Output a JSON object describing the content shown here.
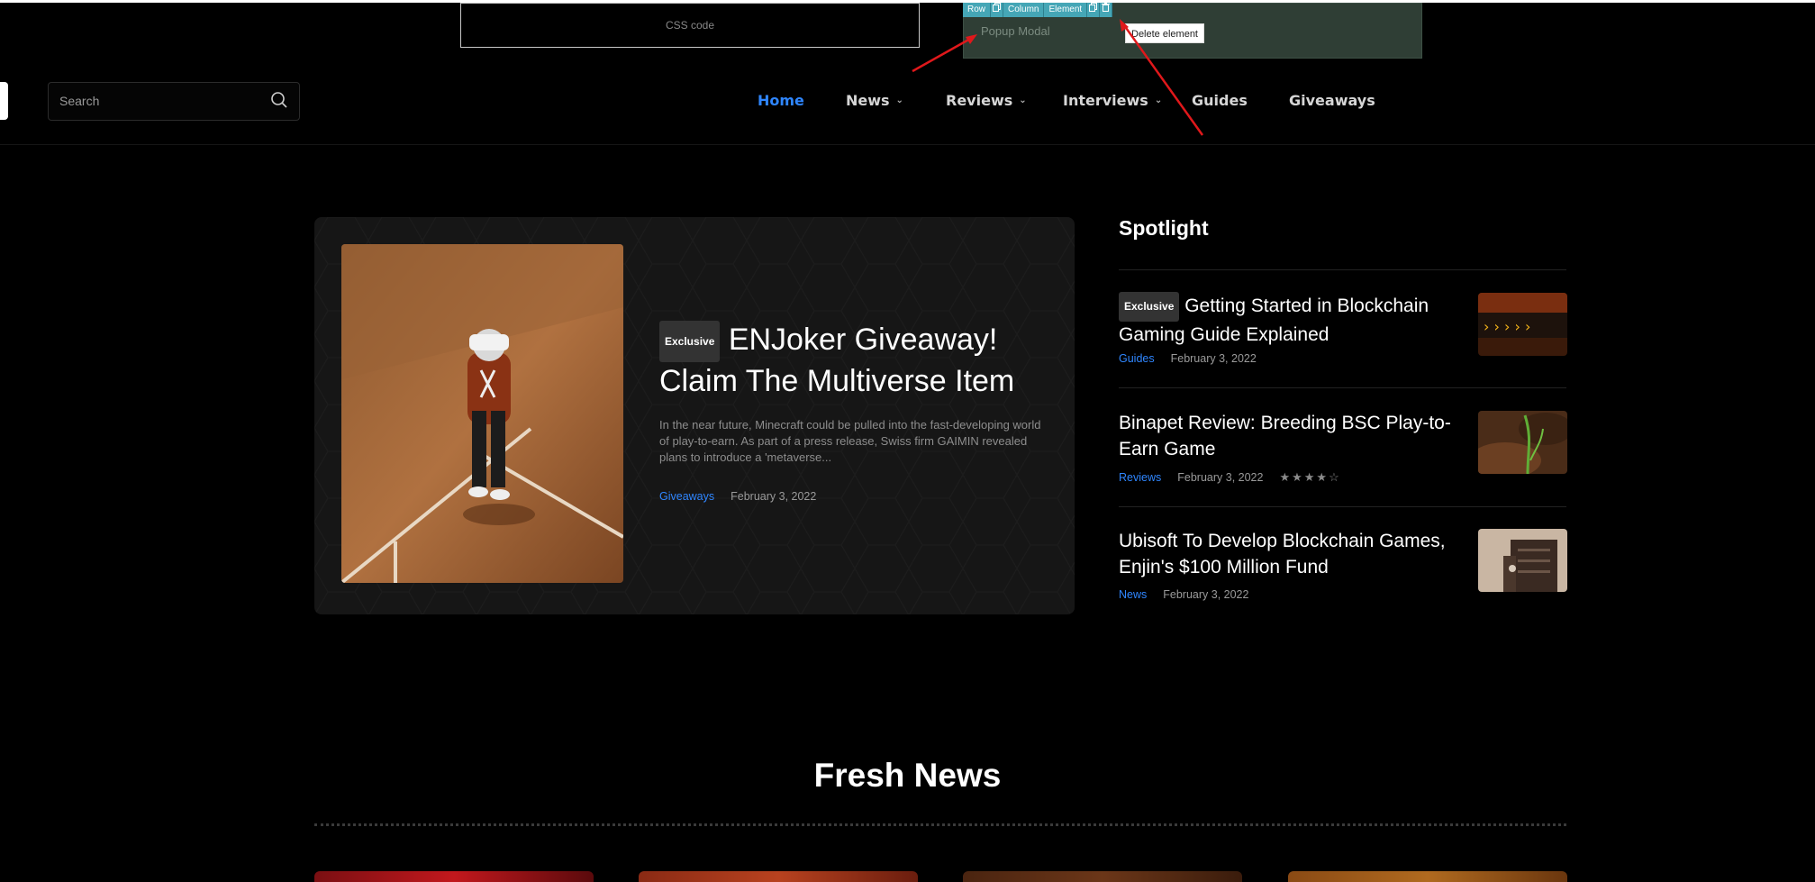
{
  "editor": {
    "css_code_label": "CSS code",
    "modal_label": "Popup Modal",
    "toolbar": [
      "Row",
      "Column",
      "Element"
    ],
    "tooltip": "Delete element"
  },
  "header": {
    "search_placeholder": "Search",
    "nav": [
      {
        "label": "Home",
        "active": true,
        "dropdown": false
      },
      {
        "label": "News",
        "active": false,
        "dropdown": true
      },
      {
        "label": "Reviews",
        "active": false,
        "dropdown": true
      },
      {
        "label": "Interviews",
        "active": false,
        "dropdown": true
      },
      {
        "label": "Guides",
        "active": false,
        "dropdown": false
      },
      {
        "label": "Giveaways",
        "active": false,
        "dropdown": false
      }
    ]
  },
  "featured": {
    "badge": "Exclusive",
    "title": "ENJoker Giveaway! Claim The Multiverse Item",
    "excerpt": "In the near future, Minecraft could be pulled into the fast-developing world of play-to-earn. As part of a press release, Swiss firm GAIMIN revealed plans to introduce a 'metaverse...",
    "category": "Giveaways",
    "date": "February 3, 2022"
  },
  "spotlight": {
    "heading": "Spotlight",
    "items": [
      {
        "badge": "Exclusive",
        "title": "Getting Started in Blockchain Gaming Guide Explained",
        "category": "Guides",
        "date": "February 3, 2022"
      },
      {
        "badge": "",
        "title": "Binapet Review: Breeding BSC Play-to-Earn Game",
        "category": "Reviews",
        "date": "February 3, 2022",
        "rating": "★★★★☆"
      },
      {
        "badge": "",
        "title": "Ubisoft To Develop Blockchain Games, Enjin's $100 Million Fund",
        "category": "News",
        "date": "February 3, 2022"
      }
    ]
  },
  "fresh_news": {
    "heading": "Fresh News"
  },
  "colors": {
    "accent": "#2f86ff",
    "background": "#000000",
    "card": "#161616",
    "toolbar": "#45a6b6"
  }
}
